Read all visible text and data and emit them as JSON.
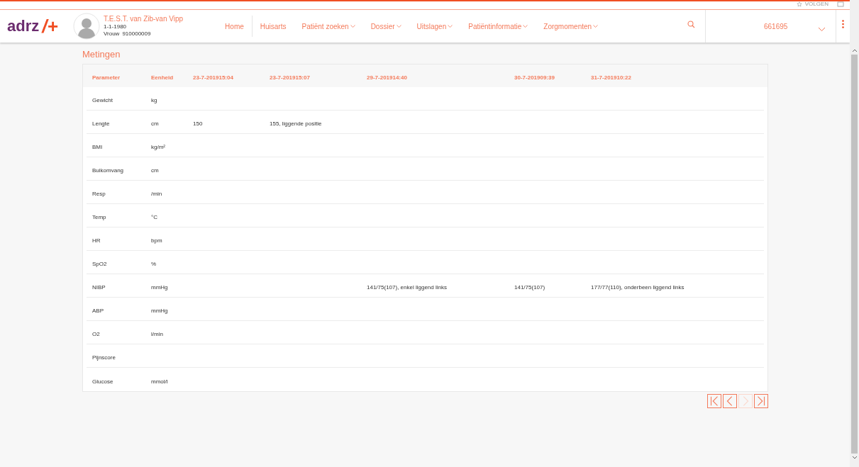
{
  "topbar": {
    "follow_label": "VOLGEN"
  },
  "header": {
    "logo": {
      "text": "adrz",
      "symbol": "/+"
    },
    "patient": {
      "name": "T.E.S.T. van Zib-van Vipp",
      "birthdate": "1-1-1980",
      "sex": "Vrouw",
      "id": "910000009"
    },
    "nav": [
      {
        "label": "Home",
        "dropdown": false
      },
      {
        "label": "Huisarts",
        "dropdown": false
      },
      {
        "label": "Patiënt zoeken",
        "dropdown": true
      },
      {
        "label": "Dossier",
        "dropdown": true
      },
      {
        "label": "Uitslagen",
        "dropdown": true
      },
      {
        "label": "Patiëntinformatie",
        "dropdown": true
      },
      {
        "label": "Zorgmomenten",
        "dropdown": true
      }
    ],
    "account": "661695"
  },
  "page_title": "Metingen",
  "table": {
    "columns": [
      "Parameter",
      "Eenheid",
      "23-7-201915:04",
      "23-7-201915:07",
      "29-7-201914:40",
      "30-7-201909:39",
      "31-7-201910:22"
    ],
    "rows": [
      [
        "Gewicht",
        "kg",
        "",
        "",
        "",
        "",
        ""
      ],
      [
        "Lengte",
        "cm",
        "150",
        "155, liggende positie",
        "",
        "",
        ""
      ],
      [
        "BMI",
        "kg/m²",
        "",
        "",
        "",
        "",
        ""
      ],
      [
        "Buikomvang",
        "cm",
        "",
        "",
        "",
        "",
        ""
      ],
      [
        "Resp",
        "/min",
        "",
        "",
        "",
        "",
        ""
      ],
      [
        "Temp",
        "°C",
        "",
        "",
        "",
        "",
        ""
      ],
      [
        "HR",
        "bpm",
        "",
        "",
        "",
        "",
        ""
      ],
      [
        "SpO2",
        "%",
        "",
        "",
        "",
        "",
        ""
      ],
      [
        "NIBP",
        "mmHg",
        "",
        "",
        "141/75(107), enkel liggend links",
        "141/75(107)",
        "177/77(110), onderbeen liggend links"
      ],
      [
        "ABP",
        "mmHg",
        "",
        "",
        "",
        "",
        ""
      ],
      [
        "O2",
        "l/min",
        "",
        "",
        "",
        "",
        ""
      ],
      [
        "Pijnscore",
        "",
        "",
        "",
        "",
        "",
        ""
      ],
      [
        "Glucose",
        "mmol/l",
        "",
        "",
        "",
        "",
        ""
      ]
    ]
  },
  "pagination": [
    {
      "kind": "first",
      "disabled": false
    },
    {
      "kind": "prev",
      "disabled": false
    },
    {
      "kind": "next",
      "disabled": true
    },
    {
      "kind": "last",
      "disabled": false
    }
  ]
}
